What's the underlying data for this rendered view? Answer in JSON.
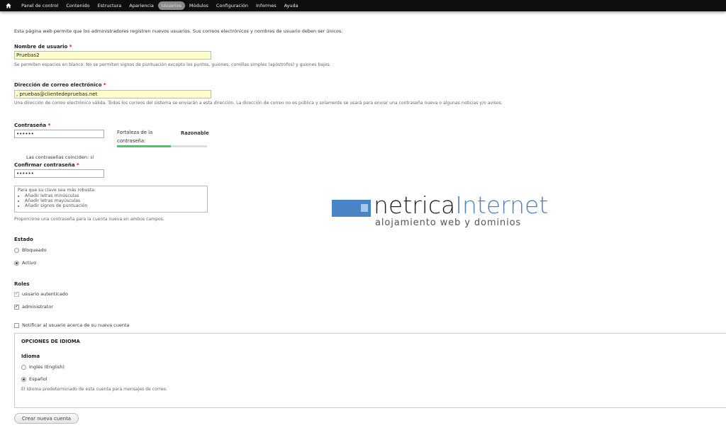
{
  "toolbar": {
    "items": [
      {
        "label": "Panel de control"
      },
      {
        "label": "Contenido"
      },
      {
        "label": "Estructura"
      },
      {
        "label": "Apariencia"
      },
      {
        "label": "Usuarios",
        "active": true
      },
      {
        "label": "Módulos"
      },
      {
        "label": "Configuración"
      },
      {
        "label": "Informes"
      },
      {
        "label": "Ayuda"
      }
    ],
    "home_icon": "home-icon"
  },
  "intro": "Esta página web permite que los administradores registren nuevos usuarios. Sus correos electrónicos y nombres de usuario deben ser únicos.",
  "username": {
    "label": "Nombre de usuario",
    "required": "*",
    "value": "Pruebas2",
    "description": "Se permiten espacios en blanco. No se permiten signos de puntuación excepto los puntos, guiones, comillas simples (apóstrofos) y guiones bajos."
  },
  "email": {
    "label": "Dirección de correo electrónico",
    "required": "*",
    "value": ", pruebas@clientedepruebas.net",
    "description": "Una dirección de correo electrónico válida. Todos los correos del sistema se enviarán a esta dirección. La dirección de correo no es pública y solamente se usará para enviar una contraseña nueva o algunas noticias y/o avisos."
  },
  "password": {
    "label": "Contraseña",
    "required": "*",
    "value": "••••••",
    "strength_label": "Fortaleza de la contraseña:",
    "strength_value": "Razonable",
    "strength_fraction": 0.6,
    "match_label": "Las contraseñas coinciden:",
    "match_value": "sí",
    "confirm_label": "Confirmar contraseña",
    "confirm_value": "••••••",
    "tips_title": "Para que su clave sea más robusta:",
    "tips": [
      "Añadir letras minúsculas",
      "Añadir letras mayúsculas",
      "Añadir signos de puntuación"
    ],
    "description": "Proporcione una contraseña para la cuenta nueva en ambos campos."
  },
  "status": {
    "title": "Estado",
    "options": [
      {
        "label": "Bloqueado",
        "selected": false
      },
      {
        "label": "Activo",
        "selected": true
      }
    ]
  },
  "roles": {
    "title": "Roles",
    "options": [
      {
        "label": "usuario autenticado",
        "checked": true,
        "disabled": true
      },
      {
        "label": "administrator",
        "checked": true,
        "disabled": false
      }
    ]
  },
  "notify": {
    "label": "Notificar al usuario acerca de su nueva cuenta",
    "checked": false
  },
  "language": {
    "fieldset_title": "OPCIONES DE IDIOMA",
    "title": "Idioma",
    "options": [
      {
        "label": "Inglés (English)",
        "selected": false
      },
      {
        "label": "Español",
        "selected": true
      }
    ],
    "description": "El idioma predeterminado de esta cuenta para mensajes de correo."
  },
  "submit_label": "Crear nueva cuenta",
  "watermark": {
    "word1": "netrica",
    "word2": "Internet",
    "tagline": "alojamiento web y dominios",
    "brand_color": "#4a84c4"
  }
}
